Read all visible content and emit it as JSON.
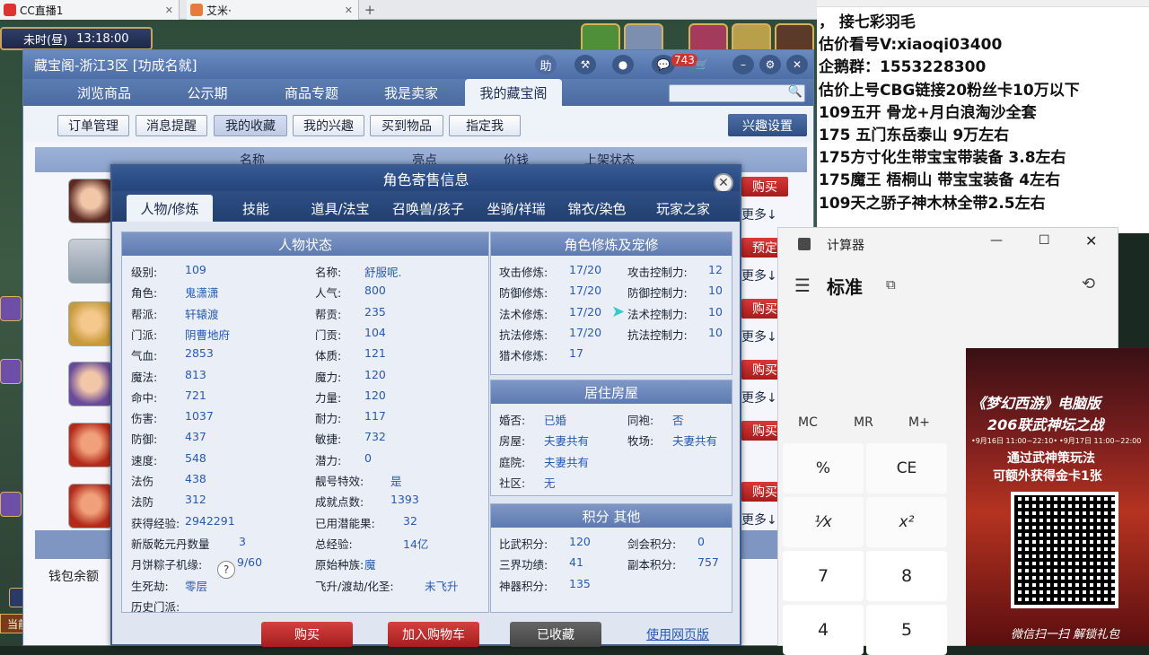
{
  "browser_tabs": [
    {
      "label": "CC直播1"
    },
    {
      "label": "艾米·"
    }
  ],
  "game": {
    "time_period": "未时(昼)",
    "clock": "13:18:00",
    "status": "当前"
  },
  "cbg": {
    "title": "藏宝阁-浙江3区 [功成名就]",
    "badge_count": "743",
    "nav": [
      "浏览商品",
      "公示期",
      "商品专题",
      "我是卖家",
      "我的藏宝阁"
    ],
    "subtabs": [
      "订单管理",
      "消息提醒",
      "我的收藏",
      "我的兴趣",
      "买到物品",
      "指定我"
    ],
    "interest_button": "兴趣设置",
    "list_headers": [
      "名称",
      "亮点",
      "价钱",
      "上架状态"
    ],
    "row_actions": [
      "购买",
      "更多",
      "预定",
      "更多",
      "购买",
      "更多",
      "购买",
      "更多",
      "购买",
      "购买",
      "更多"
    ],
    "wallet": "钱包余额"
  },
  "dialog": {
    "title": "角色寄售信息",
    "tabs": [
      "人物/修炼",
      "技能",
      "道具/法宝",
      "召唤兽/孩子",
      "坐骑/祥瑞",
      "锦衣/染色",
      "玩家之家"
    ],
    "status": {
      "header": "人物状态",
      "left": [
        [
          "级别:",
          "109"
        ],
        [
          "角色:",
          "鬼潇潇"
        ],
        [
          "帮派:",
          "轩辕渡"
        ],
        [
          "门派:",
          "阴曹地府"
        ],
        [
          "气血:",
          "2853"
        ],
        [
          "魔法:",
          "813"
        ],
        [
          "命中:",
          "721"
        ],
        [
          "伤害:",
          "1037"
        ],
        [
          "防御:",
          "437"
        ],
        [
          "速度:",
          "548"
        ],
        [
          "法伤",
          "438"
        ],
        [
          "法防",
          "312"
        ],
        [
          "获得经验:",
          "2942291"
        ],
        [
          "新版乾元丹数量",
          "3"
        ],
        [
          "月饼粽子机缘:",
          "9/60"
        ],
        [
          "生死劫:",
          "零层"
        ],
        [
          "历史门派:",
          ""
        ]
      ],
      "right": [
        [
          "名称:",
          "舒服呢."
        ],
        [
          "人气:",
          "800"
        ],
        [
          "帮贡:",
          "235"
        ],
        [
          "门贡:",
          "104"
        ],
        [
          "体质:",
          "121"
        ],
        [
          "魔力:",
          "120"
        ],
        [
          "力量:",
          "120"
        ],
        [
          "耐力:",
          "117"
        ],
        [
          "敏捷:",
          "732"
        ],
        [
          "潜力:",
          "0"
        ],
        [
          "靓号特效:",
          "是"
        ],
        [
          "成就点数:",
          "1393"
        ],
        [
          "已用潜能果:",
          "32"
        ],
        [
          "总经验:",
          "14亿"
        ],
        [
          "原始种族:",
          "魔"
        ],
        [
          "飞升/渡劫/化圣:",
          "未飞升"
        ]
      ]
    },
    "cultivation": {
      "header": "角色修炼及宠修",
      "left": [
        [
          "攻击修炼:",
          "17/20"
        ],
        [
          "防御修炼:",
          "17/20"
        ],
        [
          "法术修炼:",
          "17/20"
        ],
        [
          "抗法修炼:",
          "17/20"
        ],
        [
          "猎术修炼:",
          "17"
        ]
      ],
      "right": [
        [
          "攻击控制力:",
          "12"
        ],
        [
          "防御控制力:",
          "10"
        ],
        [
          "法术控制力:",
          "10"
        ],
        [
          "抗法控制力:",
          "10"
        ]
      ]
    },
    "house": {
      "header": "居住房屋",
      "left": [
        [
          "婚否:",
          "已婚"
        ],
        [
          "房屋:",
          "夫妻共有"
        ],
        [
          "庭院:",
          "夫妻共有"
        ],
        [
          "社区:",
          "无"
        ]
      ],
      "right": [
        [
          "同袍:",
          "否"
        ],
        [
          "牧场:",
          "夫妻共有"
        ]
      ]
    },
    "points": {
      "header": "积分 其他",
      "left": [
        [
          "比武积分:",
          "120"
        ],
        [
          "三界功绩:",
          "41"
        ],
        [
          "神器积分:",
          "135"
        ]
      ],
      "right": [
        [
          "剑会积分:",
          "0"
        ],
        [
          "副本积分:",
          "757"
        ]
      ]
    },
    "buttons": [
      "购买",
      "加入购物车",
      "已收藏",
      "使用网页版"
    ]
  },
  "notes": [
    "，    接七彩羽毛",
    "估价看号V:xiaoqi03400",
    "企鹅群：1553228300",
    "估价上号CBG链接20粉丝卡10万以下",
    "109五开 骨龙+月白浪淘沙全套",
    "175 五门东岳泰山  9万左右",
    "175方寸化生带宝宝带装备  3.8左右",
    "175魔王 梧桐山  带宝宝装备 4左右",
    "109天之骄子神木林全带2.5左右"
  ],
  "calculator": {
    "title": "计算器",
    "mode": "标准",
    "memory": [
      "MC",
      "MR",
      "M+"
    ],
    "keys": [
      "%",
      "CE",
      "¹⁄x",
      "x²",
      "7",
      "8",
      "4",
      "5"
    ]
  },
  "ad": {
    "title": "《梦幻西游》电脑版",
    "subtitle": "206联武神坛之战",
    "date1": "•9月16日 11:00~22:10•",
    "date2": "•9月17日 11:00~22:00",
    "line1": "通过武神策玩法",
    "line2": "可额外获得金卡1张",
    "footer": "微信扫一扫  解锁礼包"
  },
  "colors": {
    "accent": "#4d6ea6",
    "value": "#2659b2",
    "buy": "#c22a2a"
  }
}
